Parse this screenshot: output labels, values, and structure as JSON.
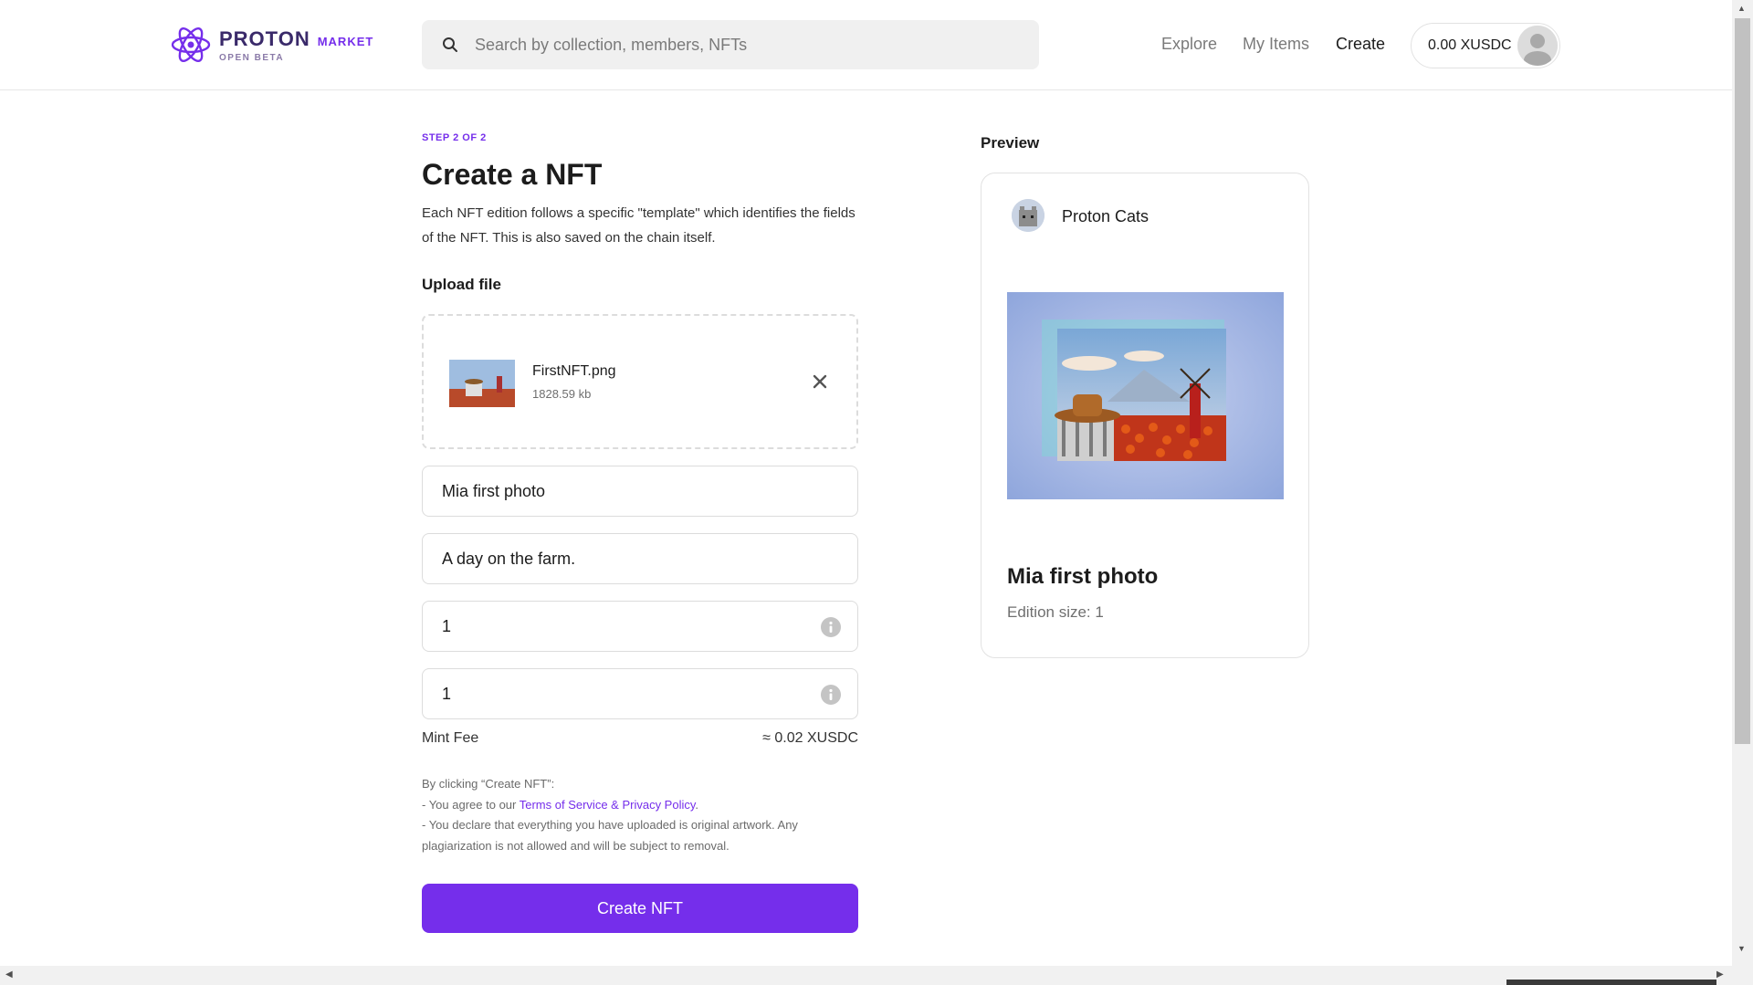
{
  "header": {
    "logo": {
      "word": "PROTON",
      "market": "MARKET",
      "beta": "OPEN BETA"
    },
    "search": {
      "placeholder": "Search by collection, members, NFTs",
      "value": ""
    },
    "nav": [
      {
        "label": "Explore",
        "active": false
      },
      {
        "label": "My Items",
        "active": false
      },
      {
        "label": "Create",
        "active": true
      }
    ],
    "wallet": {
      "balance": "0.00 XUSDC"
    }
  },
  "form": {
    "step": "STEP 2 OF 2",
    "title": "Create a NFT",
    "description": "Each NFT edition follows a specific \"template\" which identifies the fields of the NFT. This is also saved on the chain itself.",
    "upload_label": "Upload file",
    "file": {
      "name": "FirstNFT.png",
      "size": "1828.59 kb"
    },
    "fields": {
      "name": "Mia first photo",
      "description": "A day on the farm.",
      "royalties": "1",
      "edition_size": "1"
    },
    "mint_fee": {
      "label": "Mint Fee",
      "value": "≈ 0.02 XUSDC"
    },
    "terms": {
      "intro": "By clicking “Create NFT”:",
      "line1_prefix": "- You agree to our ",
      "line1_link": "Terms of Service & Privacy Policy",
      "line1_suffix": ".",
      "line2": "- You declare that everything you have uploaded is original artwork. Any plagiarization is not allowed and will be subject to removal."
    },
    "submit_label": "Create NFT"
  },
  "preview": {
    "label": "Preview",
    "collection_name": "Proton Cats",
    "nft_title": "Mia first photo",
    "edition_label": "Edition size: 1"
  },
  "colors": {
    "accent": "#752eeb",
    "border": "#dcdcdc",
    "muted_text": "#6f6f6f"
  }
}
